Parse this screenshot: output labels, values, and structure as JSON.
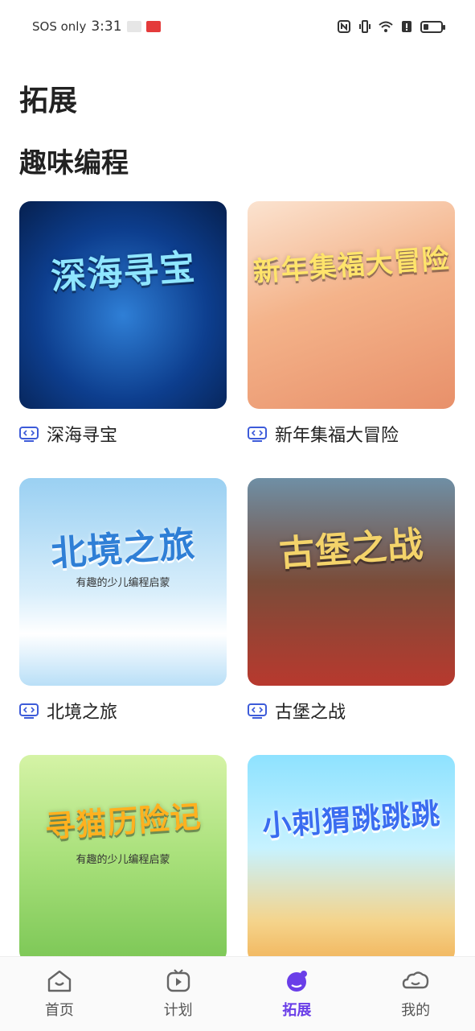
{
  "status_bar": {
    "carrier": "SOS only",
    "time": "3:31",
    "icons": [
      "nfc-icon",
      "vibrate-icon",
      "wifi-icon",
      "alert-icon",
      "battery-icon"
    ],
    "battery_level": 0.2
  },
  "header": {
    "page_title": "拓展",
    "section_title": "趣味编程"
  },
  "cards": [
    {
      "label": "深海寻宝",
      "art_text": "深海寻宝",
      "icon": "screen-icon"
    },
    {
      "label": "新年集福大冒险",
      "art_text": "新年集福大冒险",
      "icon": "screen-icon"
    },
    {
      "label": "北境之旅",
      "art_text": "北境之旅",
      "art_sub": "有趣的少儿编程启蒙",
      "icon": "screen-icon"
    },
    {
      "label": "古堡之战",
      "art_text": "古堡之战",
      "icon": "screen-icon"
    },
    {
      "art_text": "寻猫历险记",
      "art_sub": "有趣的少儿编程启蒙"
    },
    {
      "art_text": "小刺猬跳跳跳"
    }
  ],
  "bottom_nav": {
    "items": [
      {
        "label": "首页",
        "icon": "home-icon"
      },
      {
        "label": "计划",
        "icon": "tv-play-icon"
      },
      {
        "label": "拓展",
        "icon": "planet-icon",
        "active": true
      },
      {
        "label": "我的",
        "icon": "profile-cloud-icon"
      }
    ]
  },
  "colors": {
    "accent": "#6a3ee8",
    "icon_blue": "#3d5bd9",
    "text": "#222222"
  }
}
